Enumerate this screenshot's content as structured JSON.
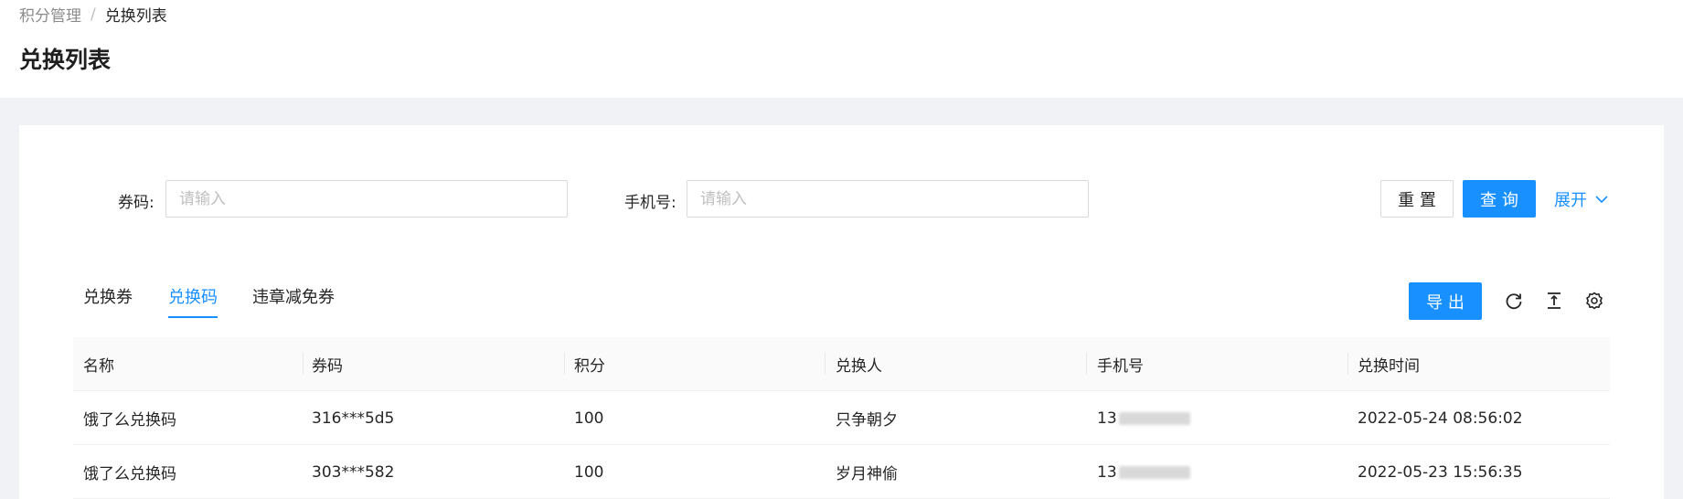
{
  "breadcrumb": {
    "parent": "积分管理",
    "separator": "/",
    "current": "兑换列表"
  },
  "page_title": "兑换列表",
  "search": {
    "code_label": "券码:",
    "code_placeholder": "请输入",
    "phone_label": "手机号:",
    "phone_placeholder": "请输入",
    "reset_label": "重 置",
    "query_label": "查 询",
    "expand_label": "展开"
  },
  "tabs": [
    {
      "label": "兑换券",
      "active": false
    },
    {
      "label": "兑换码",
      "active": true
    },
    {
      "label": "违章减免券",
      "active": false
    }
  ],
  "toolbar": {
    "export_label": "导 出",
    "icons": [
      "reload-icon",
      "column-height-icon",
      "setting-icon"
    ]
  },
  "table": {
    "columns": [
      "名称",
      "券码",
      "积分",
      "兑换人",
      "手机号",
      "兑换时间"
    ],
    "rows": [
      {
        "name": "饿了么兑换码",
        "code": "316***5d5",
        "points": "100",
        "user": "只争朝夕",
        "phone": "13",
        "time": "2022-05-24 08:56:02"
      },
      {
        "name": "饿了么兑换码",
        "code": "303***582",
        "points": "100",
        "user": "岁月神偷",
        "phone": "13",
        "time": "2022-05-23 15:56:35"
      }
    ]
  },
  "colors": {
    "primary": "#1890ff",
    "text": "#262626",
    "muted": "#8c8c8c",
    "border": "#d9d9d9",
    "page_bg": "#f0f2f5"
  }
}
